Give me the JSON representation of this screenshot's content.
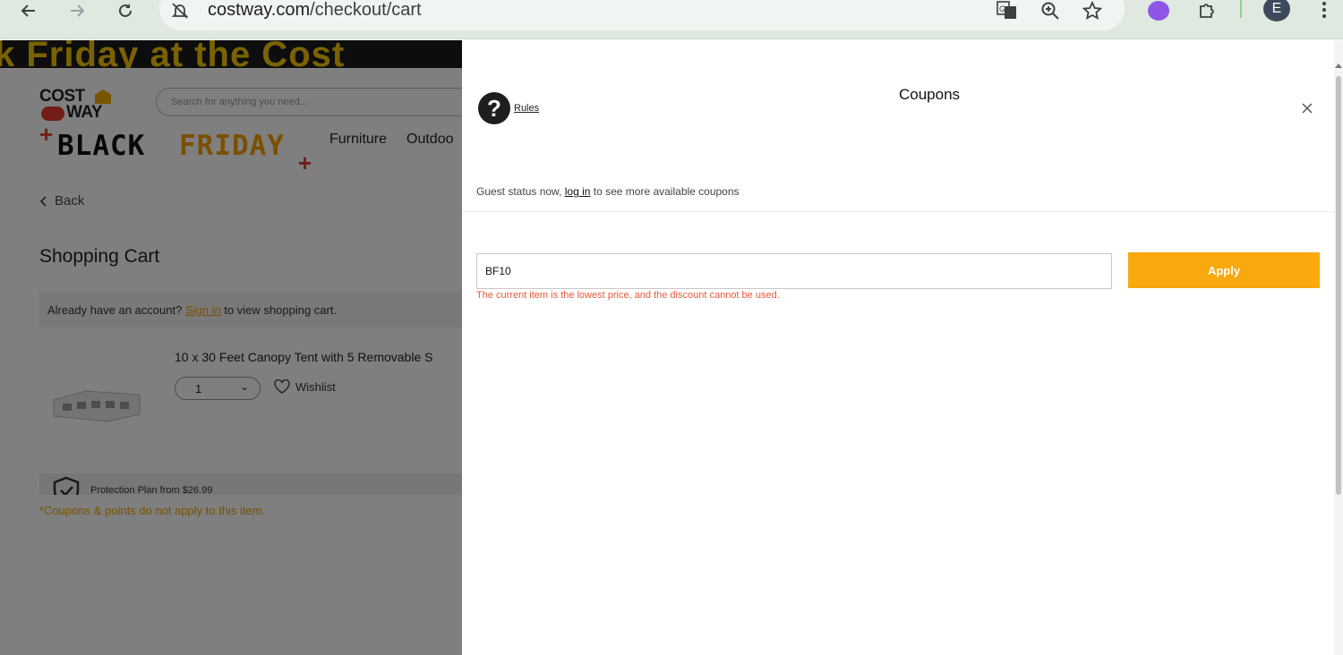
{
  "browser": {
    "url_host": "costway.com",
    "url_path": "/checkout/cart",
    "profile_initial": "E"
  },
  "site": {
    "promo_banner": "k Friday at the Cost",
    "logo_top": "COST",
    "logo_bottom": "WAY",
    "search_placeholder": "Search for anything you need...",
    "black_friday_word1": "BLACK",
    "black_friday_word2": "FRIDAY",
    "menu": [
      "Furniture",
      "Outdoo"
    ]
  },
  "cart": {
    "back_label": "Back",
    "title": "Shopping Cart",
    "signin_prefix": "Already have an account?",
    "signin_link": "Sign in",
    "signin_suffix": "to view shopping cart.",
    "product_title": "10 x 30 Feet Canopy Tent with 5 Removable S",
    "quantity": "1",
    "wishlist_label": "Wishlist",
    "protection_text": "Protection Plan from $26.99",
    "coupon_note": "*Coupons & points do not apply to this item."
  },
  "coupons": {
    "title": "Coupons",
    "rules_label": "Rules",
    "guest_prefix": "Guest status now,",
    "login_link": "log in",
    "guest_suffix": "to see more available coupons",
    "code_value": "BF10",
    "apply_label": "Apply",
    "error_message": "The current item is the lowest price, and the discount cannot be used."
  },
  "colors": {
    "apply_button": "#f9a80e",
    "error_text": "#e65a3b",
    "accent_orange": "#f5a000"
  }
}
